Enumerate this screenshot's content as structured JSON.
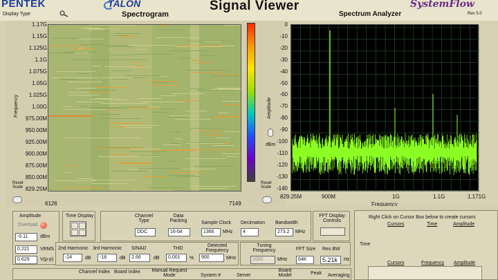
{
  "header": {
    "logo_left": "PENTEK",
    "logo_talon": "TALON",
    "display_type": "Display Type",
    "spectrogram_title": "Spectrogram",
    "app_title": "Signal Viewer",
    "analyzer_title": "Spectrum Analyzer",
    "sysflow": "SystemFlow",
    "rev": "Rev 5.0"
  },
  "spectrogram": {
    "y_label": "Frequency",
    "y_ticks": [
      "1.17G",
      "1.15G",
      "1.125G",
      "1.1G",
      "1.075G",
      "1.05G",
      "1.025G",
      "1.00G",
      "975.00M",
      "950.00M",
      "925.00M",
      "900.00M",
      "875.00M",
      "850.00M",
      "829.25M"
    ],
    "x_start": "6126",
    "x_end": "7149",
    "reset_scale": "Reset Scale"
  },
  "analyzer": {
    "y_label": "Amplitude",
    "y_ticks": [
      "0",
      "-10",
      "-20",
      "-30",
      "-40",
      "-50",
      "-60",
      "-70",
      "-80",
      "-90",
      "-100",
      "-110",
      "-120",
      "-130",
      "-140"
    ],
    "x_ticks": [
      "829.25M",
      "900M",
      "1G",
      "1.1G",
      "1.171G"
    ],
    "x_label": "Frequency",
    "dbm": "dBm",
    "reset_scale": "Reset Scale"
  },
  "controls": {
    "amplitude_label": "Amplitude",
    "overload": "Overload",
    "amp_value": "-0.11",
    "amp_unit": "dBm",
    "vrms_value": "0.221",
    "vrms_unit": "VRMS",
    "vpp_value": "0.629",
    "vpp_unit": "V(p-p)",
    "time_display": "Time Display",
    "channel_type_label": "Channel Type",
    "channel_type": "DDC",
    "data_packing_label": "Data Packing",
    "data_packing": "16-bit",
    "sample_clock_label": "Sample Clock",
    "sample_clock": "1366",
    "sample_clock_unit": "MHz",
    "decimation_label": "Decimation",
    "decimation": "4",
    "bandwidth_label": "Bandwidth",
    "bandwidth": "273.2",
    "bandwidth_unit": "MHz",
    "fft_display_label": "FFT Display Controls",
    "h2_label": "2nd Harmonic",
    "h2": "-24",
    "h3_label": "3rd Harmonic",
    "h3": "-18",
    "db": "dB",
    "sinad_label": "SINAD",
    "sinad": "2.66",
    "thd_label": "THD",
    "thd": "0.001",
    "pct": "%",
    "detected_label": "Detected Frequency",
    "detected": "900",
    "mhz": "MHz",
    "tuning_label": "Tuning Frequency",
    "tuning": "1000",
    "fft_size_label": "FFT Size",
    "fft_size": "64K",
    "res_bw_label": "Res BW",
    "res_bw": "5.21k",
    "hz": "Hz",
    "channel_index": "Channel Index",
    "board_index": "Board Index",
    "manual_request": "Manual Request Mode",
    "system": "System #",
    "server": "Server",
    "board_model": "Board Model",
    "peak": "Peak",
    "averaging": "Averaging"
  },
  "cursors": {
    "hint": "Right Click on Cursor Box below to create cursors",
    "col1": "Cursors",
    "col2": "Time",
    "col3": "Amplitude",
    "side_label": "Time",
    "col4": "Cursors",
    "col5": "Frequency",
    "col6": "Amplitude"
  }
}
